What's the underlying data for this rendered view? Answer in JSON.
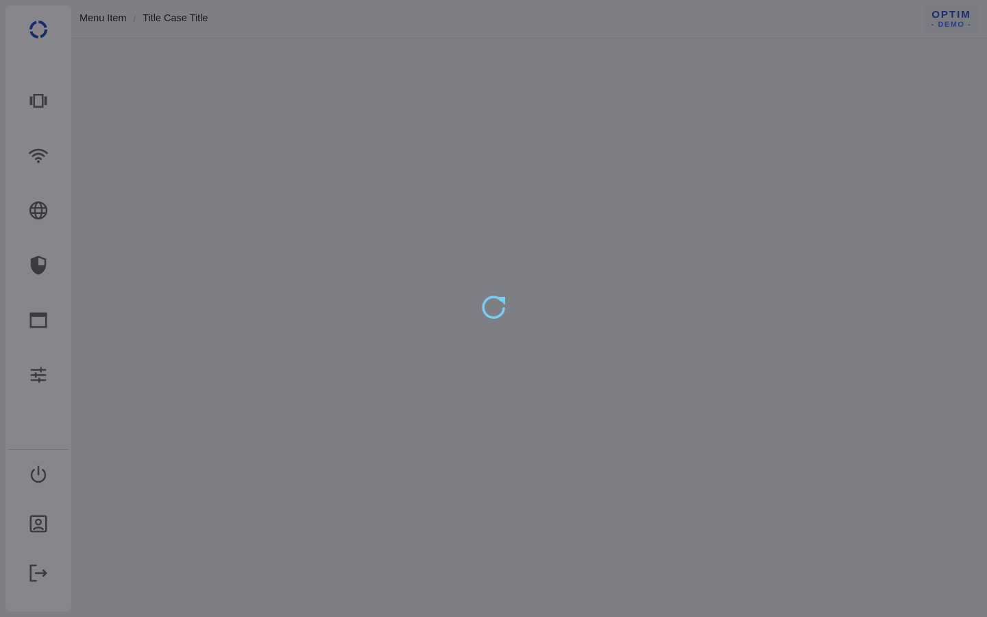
{
  "breadcrumb": {
    "parent": "Menu Item",
    "separator": "/",
    "current": "Title Case Title"
  },
  "brand": {
    "title": "OPTIM",
    "subtitle": "- DEMO -"
  },
  "sidebar": {
    "logo_icon": "ring-logo-icon",
    "items": [
      {
        "icon": "carousel-icon"
      },
      {
        "icon": "wifi-icon"
      },
      {
        "icon": "globe-icon"
      },
      {
        "icon": "shield-icon"
      },
      {
        "icon": "window-icon"
      },
      {
        "icon": "sliders-icon"
      }
    ],
    "bottom_items": [
      {
        "icon": "power-icon"
      },
      {
        "icon": "account-box-icon"
      },
      {
        "icon": "logout-icon"
      }
    ]
  },
  "loading": {
    "icon": "refresh-spinner-icon"
  },
  "colors": {
    "overlay": "#7e7f84",
    "icon": "#3a3b3f",
    "spinner": "#7ecbf2",
    "brand": "#1b2a6a"
  }
}
